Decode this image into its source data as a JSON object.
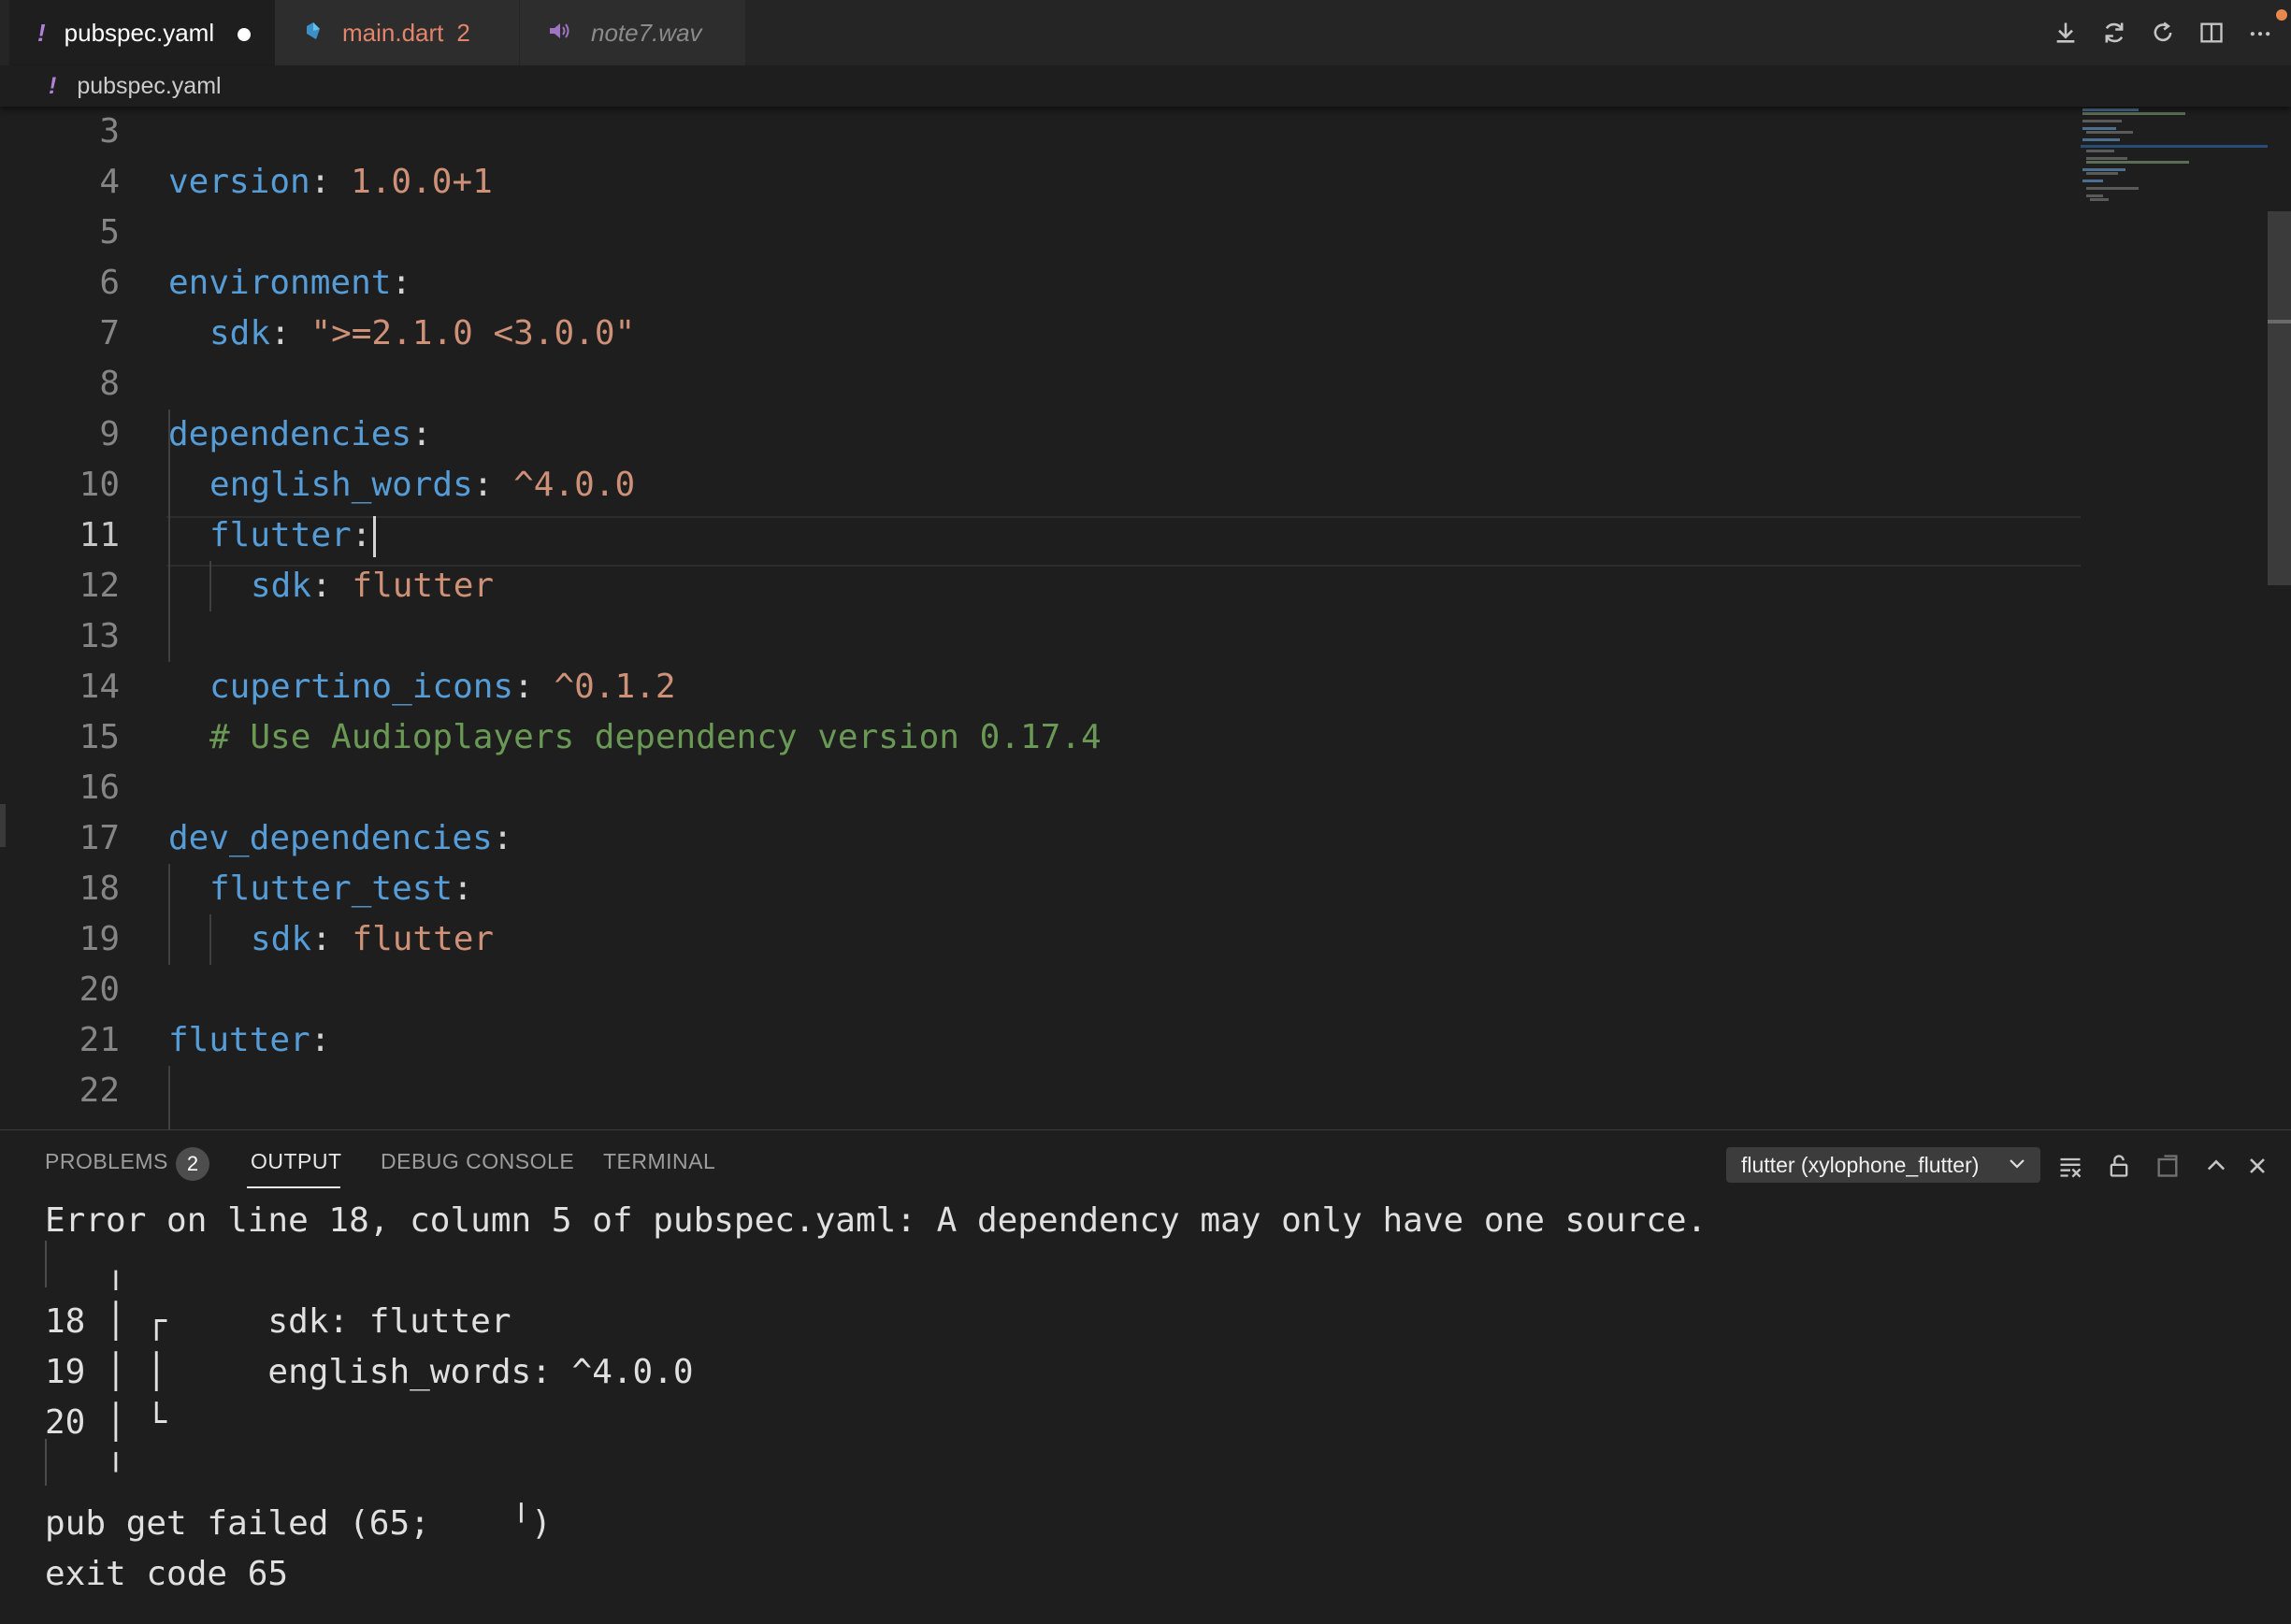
{
  "tabs": [
    {
      "icon": "!",
      "label": "pubspec.yaml",
      "modified": true
    },
    {
      "icon": "dart",
      "label": "main.dart",
      "count": "2"
    },
    {
      "icon": "audio",
      "label": "note7.wav"
    }
  ],
  "breadcrumb": {
    "icon": "!",
    "label": "pubspec.yaml"
  },
  "editor": {
    "lines": [
      {
        "n": "3"
      },
      {
        "n": "4",
        "k": "version",
        "v": "1.0.0+1"
      },
      {
        "n": "5"
      },
      {
        "n": "6",
        "k": "environment"
      },
      {
        "n": "7",
        "k": "sdk",
        "v": "\">=2.1.0 <3.0.0\""
      },
      {
        "n": "8"
      },
      {
        "n": "9",
        "k": "dependencies"
      },
      {
        "n": "10",
        "k": "english_words",
        "v": "^4.0.0"
      },
      {
        "n": "11",
        "k": "flutter"
      },
      {
        "n": "12",
        "k": "sdk",
        "v": "flutter"
      },
      {
        "n": "13"
      },
      {
        "n": "14",
        "k": "cupertino_icons",
        "v": "^0.1.2"
      },
      {
        "n": "15",
        "c": "# Use Audioplayers dependency version 0.17.4"
      },
      {
        "n": "16"
      },
      {
        "n": "17",
        "k": "dev_dependencies"
      },
      {
        "n": "18",
        "k": "flutter_test"
      },
      {
        "n": "19",
        "k": "sdk",
        "v": "flutter"
      },
      {
        "n": "20"
      },
      {
        "n": "21",
        "k": "flutter"
      },
      {
        "n": "22"
      }
    ]
  },
  "panel": {
    "tabs": {
      "problems": "PROBLEMS",
      "output": "OUTPUT",
      "debug": "DEBUG CONSOLE",
      "terminal": "TERMINAL"
    },
    "problems_count": "2",
    "channel": "flutter (xylophone_flutter)",
    "output_lines": {
      "error": "Error on line 18, column 5 of pubspec.yaml: A dependency may only have one source.",
      "pipe_top": "   ╷",
      "l18": "18 │ ┌     sdk: flutter",
      "l19": "19 │ │     english_words: ^4.0.0",
      "l20": "20 │ └",
      "pipe_bottom": "   ╵",
      "failed": "pub get failed (65;    ╵)",
      "exit": "exit code 65"
    }
  },
  "colors": {
    "key": "#569cd6",
    "value": "#ce9178",
    "comment": "#6a9955",
    "accent": "#e8874c"
  }
}
